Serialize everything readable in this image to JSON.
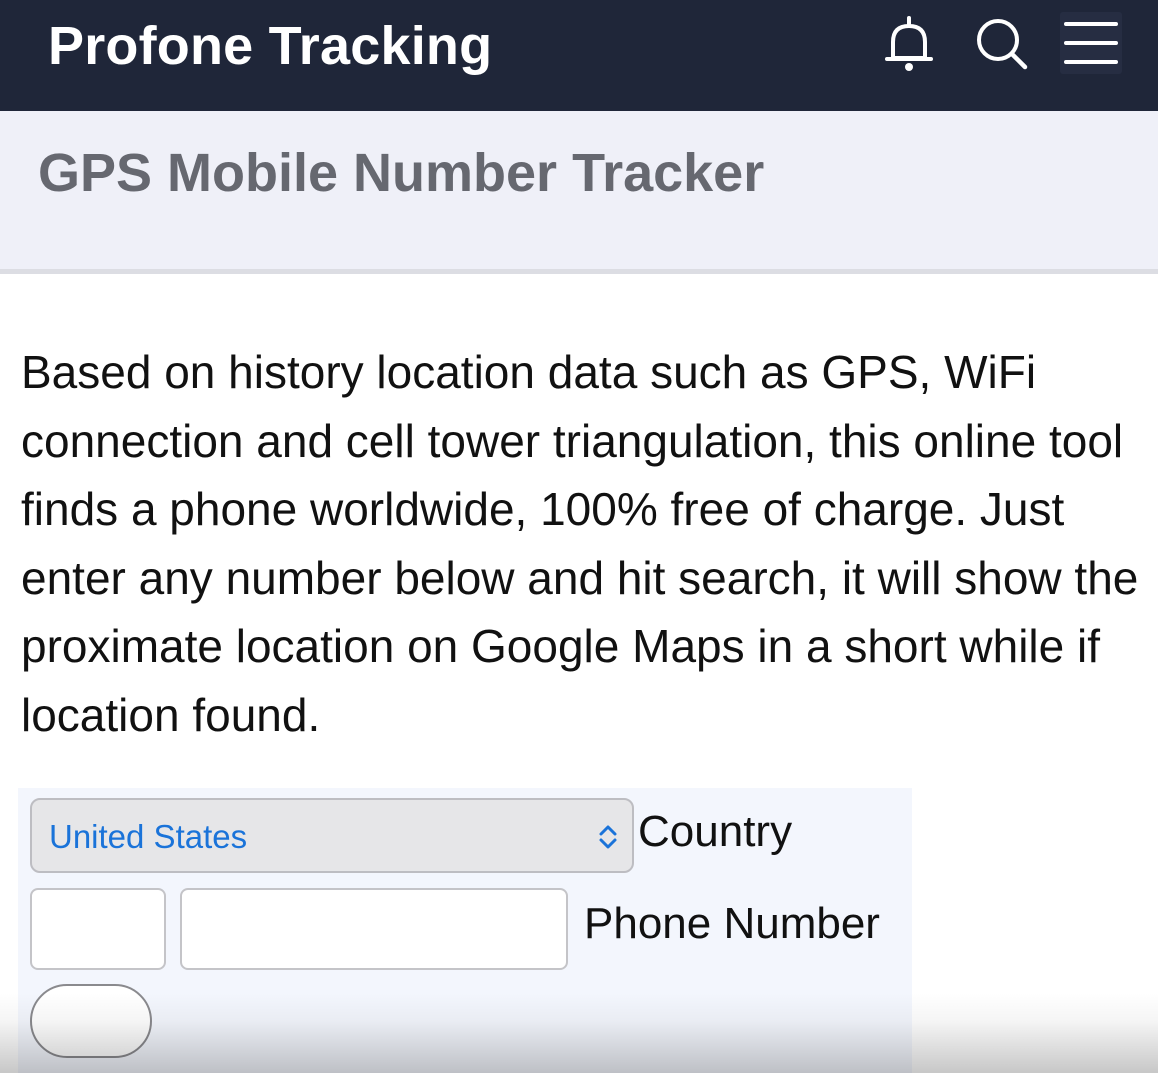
{
  "header": {
    "site_title": "Profone Tracking",
    "icons": [
      "bell-icon",
      "search-icon",
      "menu-icon"
    ]
  },
  "subheader": {
    "title": "GPS Mobile Number Tracker"
  },
  "intro": {
    "text": "Based on history location data such as GPS, WiFi connection and cell tower triangulation, this online tool finds a phone worldwide, 100% free of charge. Just enter any number below and hit search, it will show the proximate location on Google Maps in a short while if location found."
  },
  "form": {
    "country_selected": "United States",
    "country_label": "Country",
    "code_value": "",
    "phone_value": "",
    "phone_label": "Phone Number",
    "submit_label": ""
  },
  "colors": {
    "topbar": "#1f2639",
    "subheader": "#eff0f8",
    "select_text": "#1a73d9",
    "form_panel": "#f3f6fd"
  }
}
